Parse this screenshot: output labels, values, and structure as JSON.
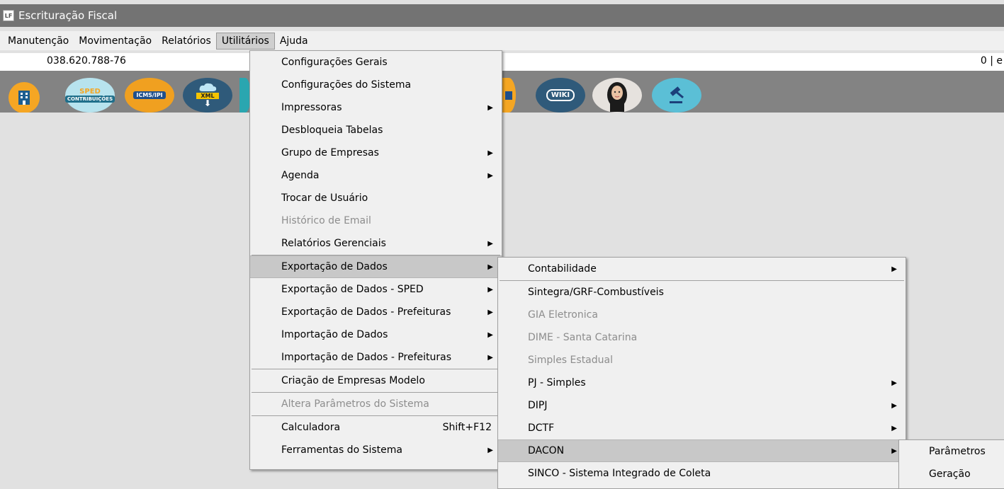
{
  "app": {
    "title": "Escrituração Fiscal",
    "icon": "LF"
  },
  "menubar": [
    "Manutenção",
    "Movimentação",
    "Relatórios",
    "Utilitários",
    "Ajuda"
  ],
  "status": {
    "cpf": "038.620.788-76",
    "counter": "0 | e"
  },
  "toolbar": {
    "sped_label": "SPED",
    "sped_sub": "CONTRIBUIÇÕES",
    "icms_label": "ICMS/IPI",
    "xml_label": "XML",
    "wiki_label": "WIKI"
  },
  "utilitarios_menu": {
    "items": [
      "Configurações Gerais",
      "Configurações do Sistema",
      "Impressoras",
      "Desbloqueia Tabelas",
      "Grupo de Empresas",
      "Agenda",
      "Trocar de Usuário",
      "Histórico de Email",
      "Relatórios Gerenciais",
      "Exportação de Dados",
      "Exportação de Dados - SPED",
      "Exportação de Dados - Prefeituras",
      "Importação de Dados",
      "Importação de Dados - Prefeituras",
      "Criação de Empresas Modelo",
      "Altera Parâmetros do Sistema",
      "Calculadora",
      "Ferramentas do Sistema"
    ],
    "calc_shortcut": "Shift+F12"
  },
  "exportacao_menu": {
    "items": [
      "Contabilidade",
      "Sintegra/GRF-Combustíveis",
      "GIA Eletronica",
      "DIME - Santa Catarina",
      "Simples Estadual",
      "PJ - Simples",
      "DIPJ",
      "DCTF",
      "DACON",
      "SINCO - Sistema Integrado de Coleta"
    ]
  },
  "dacon_menu": {
    "items": [
      "Parâmetros",
      "Geração"
    ]
  },
  "colors": {
    "titlebar": "#737373",
    "toolbar": "#838383",
    "highlight": "#c8c8c8",
    "disabled": "#8d8d8d"
  }
}
